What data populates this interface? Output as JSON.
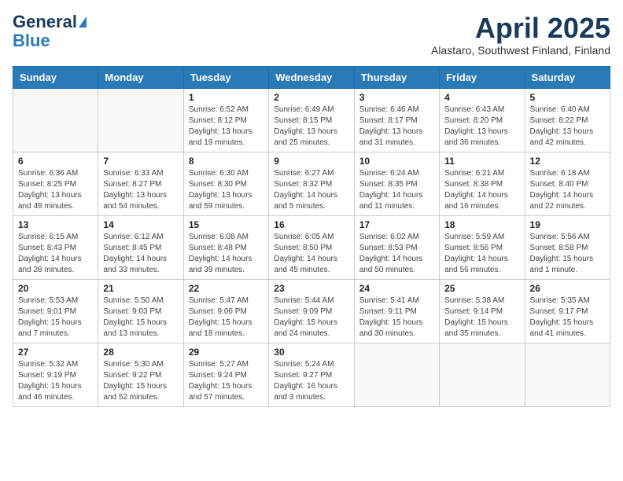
{
  "header": {
    "logo_general": "General",
    "logo_blue": "Blue",
    "title": "April 2025",
    "subtitle": "Alastaro, Southwest Finland, Finland"
  },
  "days_of_week": [
    "Sunday",
    "Monday",
    "Tuesday",
    "Wednesday",
    "Thursday",
    "Friday",
    "Saturday"
  ],
  "weeks": [
    [
      {
        "day": "",
        "sunrise": "",
        "sunset": "",
        "daylight": ""
      },
      {
        "day": "",
        "sunrise": "",
        "sunset": "",
        "daylight": ""
      },
      {
        "day": "1",
        "sunrise": "Sunrise: 6:52 AM",
        "sunset": "Sunset: 8:12 PM",
        "daylight": "Daylight: 13 hours and 19 minutes."
      },
      {
        "day": "2",
        "sunrise": "Sunrise: 6:49 AM",
        "sunset": "Sunset: 8:15 PM",
        "daylight": "Daylight: 13 hours and 25 minutes."
      },
      {
        "day": "3",
        "sunrise": "Sunrise: 6:46 AM",
        "sunset": "Sunset: 8:17 PM",
        "daylight": "Daylight: 13 hours and 31 minutes."
      },
      {
        "day": "4",
        "sunrise": "Sunrise: 6:43 AM",
        "sunset": "Sunset: 8:20 PM",
        "daylight": "Daylight: 13 hours and 36 minutes."
      },
      {
        "day": "5",
        "sunrise": "Sunrise: 6:40 AM",
        "sunset": "Sunset: 8:22 PM",
        "daylight": "Daylight: 13 hours and 42 minutes."
      }
    ],
    [
      {
        "day": "6",
        "sunrise": "Sunrise: 6:36 AM",
        "sunset": "Sunset: 8:25 PM",
        "daylight": "Daylight: 13 hours and 48 minutes."
      },
      {
        "day": "7",
        "sunrise": "Sunrise: 6:33 AM",
        "sunset": "Sunset: 8:27 PM",
        "daylight": "Daylight: 13 hours and 54 minutes."
      },
      {
        "day": "8",
        "sunrise": "Sunrise: 6:30 AM",
        "sunset": "Sunset: 8:30 PM",
        "daylight": "Daylight: 13 hours and 59 minutes."
      },
      {
        "day": "9",
        "sunrise": "Sunrise: 6:27 AM",
        "sunset": "Sunset: 8:32 PM",
        "daylight": "Daylight: 14 hours and 5 minutes."
      },
      {
        "day": "10",
        "sunrise": "Sunrise: 6:24 AM",
        "sunset": "Sunset: 8:35 PM",
        "daylight": "Daylight: 14 hours and 11 minutes."
      },
      {
        "day": "11",
        "sunrise": "Sunrise: 6:21 AM",
        "sunset": "Sunset: 8:38 PM",
        "daylight": "Daylight: 14 hours and 16 minutes."
      },
      {
        "day": "12",
        "sunrise": "Sunrise: 6:18 AM",
        "sunset": "Sunset: 8:40 PM",
        "daylight": "Daylight: 14 hours and 22 minutes."
      }
    ],
    [
      {
        "day": "13",
        "sunrise": "Sunrise: 6:15 AM",
        "sunset": "Sunset: 8:43 PM",
        "daylight": "Daylight: 14 hours and 28 minutes."
      },
      {
        "day": "14",
        "sunrise": "Sunrise: 6:12 AM",
        "sunset": "Sunset: 8:45 PM",
        "daylight": "Daylight: 14 hours and 33 minutes."
      },
      {
        "day": "15",
        "sunrise": "Sunrise: 6:08 AM",
        "sunset": "Sunset: 8:48 PM",
        "daylight": "Daylight: 14 hours and 39 minutes."
      },
      {
        "day": "16",
        "sunrise": "Sunrise: 6:05 AM",
        "sunset": "Sunset: 8:50 PM",
        "daylight": "Daylight: 14 hours and 45 minutes."
      },
      {
        "day": "17",
        "sunrise": "Sunrise: 6:02 AM",
        "sunset": "Sunset: 8:53 PM",
        "daylight": "Daylight: 14 hours and 50 minutes."
      },
      {
        "day": "18",
        "sunrise": "Sunrise: 5:59 AM",
        "sunset": "Sunset: 8:56 PM",
        "daylight": "Daylight: 14 hours and 56 minutes."
      },
      {
        "day": "19",
        "sunrise": "Sunrise: 5:56 AM",
        "sunset": "Sunset: 8:58 PM",
        "daylight": "Daylight: 15 hours and 1 minute."
      }
    ],
    [
      {
        "day": "20",
        "sunrise": "Sunrise: 5:53 AM",
        "sunset": "Sunset: 9:01 PM",
        "daylight": "Daylight: 15 hours and 7 minutes."
      },
      {
        "day": "21",
        "sunrise": "Sunrise: 5:50 AM",
        "sunset": "Sunset: 9:03 PM",
        "daylight": "Daylight: 15 hours and 13 minutes."
      },
      {
        "day": "22",
        "sunrise": "Sunrise: 5:47 AM",
        "sunset": "Sunset: 9:06 PM",
        "daylight": "Daylight: 15 hours and 18 minutes."
      },
      {
        "day": "23",
        "sunrise": "Sunrise: 5:44 AM",
        "sunset": "Sunset: 9:09 PM",
        "daylight": "Daylight: 15 hours and 24 minutes."
      },
      {
        "day": "24",
        "sunrise": "Sunrise: 5:41 AM",
        "sunset": "Sunset: 9:11 PM",
        "daylight": "Daylight: 15 hours and 30 minutes."
      },
      {
        "day": "25",
        "sunrise": "Sunrise: 5:38 AM",
        "sunset": "Sunset: 9:14 PM",
        "daylight": "Daylight: 15 hours and 35 minutes."
      },
      {
        "day": "26",
        "sunrise": "Sunrise: 5:35 AM",
        "sunset": "Sunset: 9:17 PM",
        "daylight": "Daylight: 15 hours and 41 minutes."
      }
    ],
    [
      {
        "day": "27",
        "sunrise": "Sunrise: 5:32 AM",
        "sunset": "Sunset: 9:19 PM",
        "daylight": "Daylight: 15 hours and 46 minutes."
      },
      {
        "day": "28",
        "sunrise": "Sunrise: 5:30 AM",
        "sunset": "Sunset: 9:22 PM",
        "daylight": "Daylight: 15 hours and 52 minutes."
      },
      {
        "day": "29",
        "sunrise": "Sunrise: 5:27 AM",
        "sunset": "Sunset: 9:24 PM",
        "daylight": "Daylight: 15 hours and 57 minutes."
      },
      {
        "day": "30",
        "sunrise": "Sunrise: 5:24 AM",
        "sunset": "Sunset: 9:27 PM",
        "daylight": "Daylight: 16 hours and 3 minutes."
      },
      {
        "day": "",
        "sunrise": "",
        "sunset": "",
        "daylight": ""
      },
      {
        "day": "",
        "sunrise": "",
        "sunset": "",
        "daylight": ""
      },
      {
        "day": "",
        "sunrise": "",
        "sunset": "",
        "daylight": ""
      }
    ]
  ]
}
